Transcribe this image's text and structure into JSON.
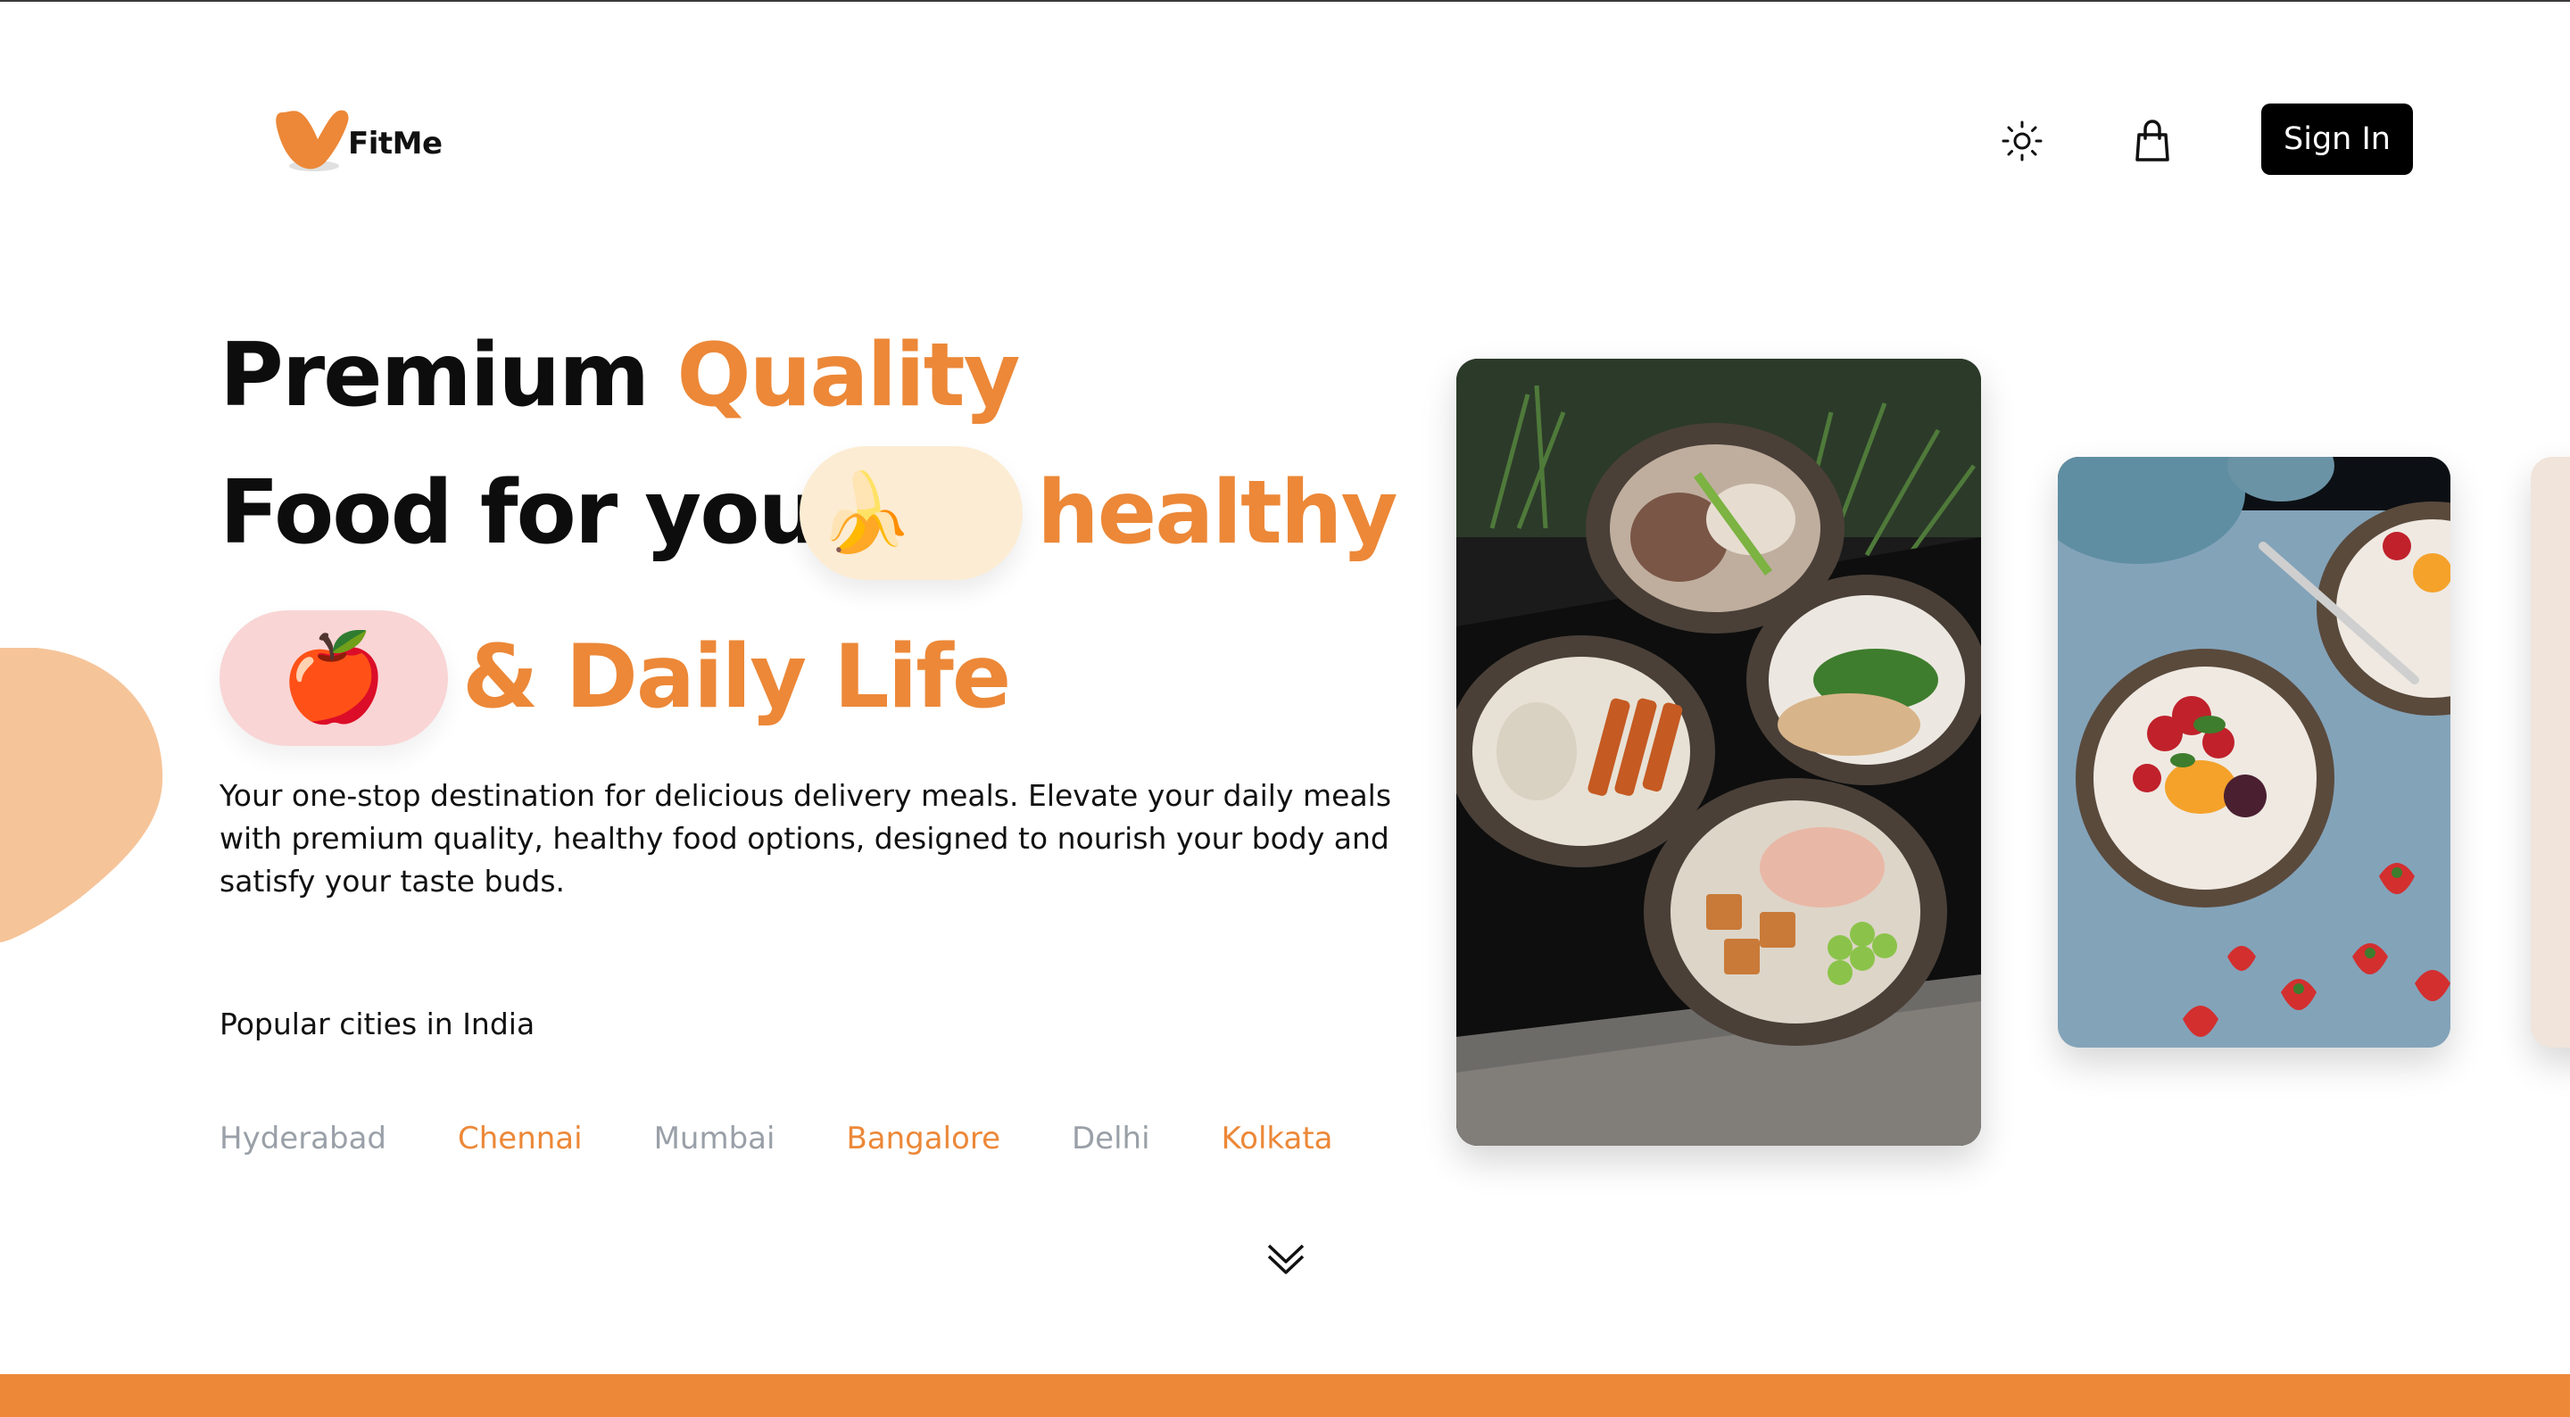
{
  "header": {
    "logo_text": "FitMe",
    "logo_icon": "fitme-logo-icon",
    "theme_icon": "sun-icon",
    "cart_icon": "shopping-bag-icon",
    "sign_in_label": "Sign In"
  },
  "hero": {
    "line1_dark": "Premium",
    "line1_accent": "Quality",
    "line2_dark": "Food for your",
    "line2_accent": "healthy",
    "line3_accent": "& Daily Life",
    "banana_emoji": "🍌",
    "apple_emoji": "🍎",
    "description": "Your one-stop destination for delicious delivery meals. Elevate your daily meals with premium quality, healthy food options, designed to nourish your body and satisfy your taste buds.",
    "cities_label": "Popular cities in India",
    "cities": [
      "Hyderabad",
      "Chennai",
      "Mumbai",
      "Bangalore",
      "Delhi",
      "Kolkata"
    ],
    "scroll_icon": "double-chevron-down-icon"
  },
  "colors": {
    "accent": "#ec8838",
    "banana_pill": "#fcecd3",
    "apple_pill": "#f9d5d5",
    "city_muted": "#9aa0a8",
    "button_dark": "#000000"
  },
  "gallery": {
    "images": [
      "meal-bowls-image",
      "fruit-porridge-image",
      "partial-food-image"
    ]
  }
}
